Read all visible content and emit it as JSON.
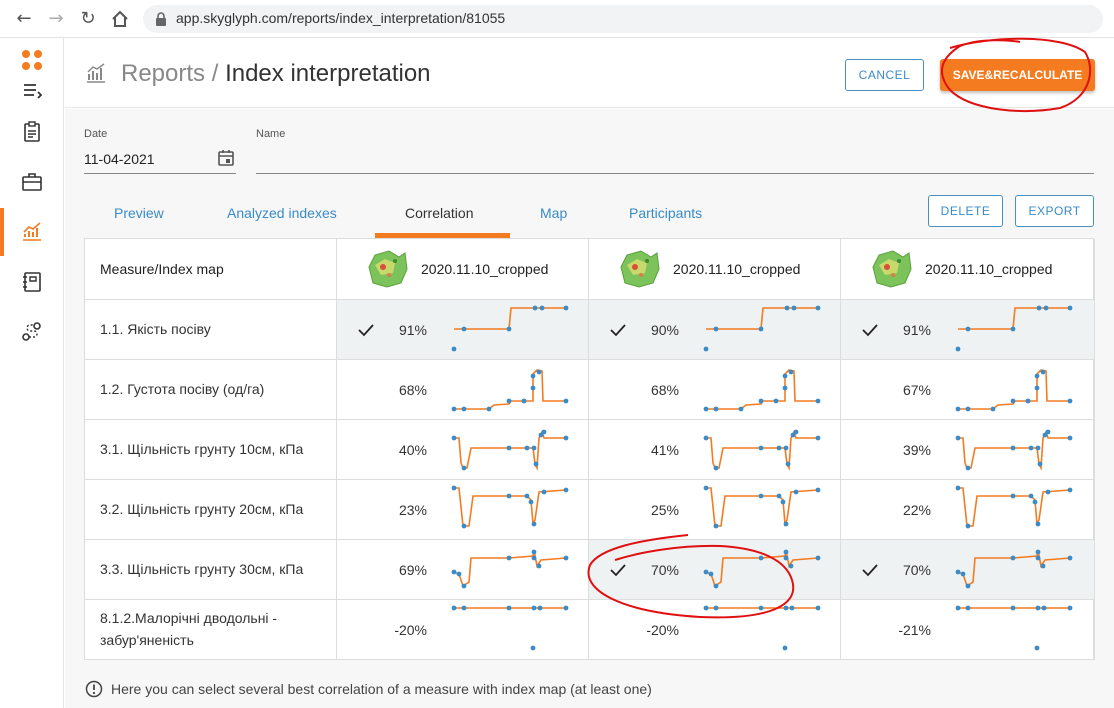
{
  "browser": {
    "url": "app.skyglyph.com/reports/index_interpretation/81055"
  },
  "sidebar": {
    "items": [
      {
        "icon": "apps-dots-icon"
      },
      {
        "icon": "menu-collapse-icon"
      },
      {
        "icon": "clipboard-icon"
      },
      {
        "icon": "briefcase-icon"
      },
      {
        "icon": "chart-growth-icon",
        "active": true
      },
      {
        "icon": "notebook-icon"
      },
      {
        "icon": "route-icon"
      }
    ]
  },
  "header": {
    "crumb": "Reports",
    "separator": " / ",
    "title": "Index interpretation",
    "cancel_label": "CANCEL",
    "save_label": "SAVE&RECALCULATE"
  },
  "form": {
    "date_label": "Date",
    "date_value": "11-04-2021",
    "name_label": "Name",
    "name_value": ""
  },
  "tabs": [
    {
      "label": "Preview"
    },
    {
      "label": "Analyzed indexes"
    },
    {
      "label": "Correlation",
      "active": true
    },
    {
      "label": "Map"
    },
    {
      "label": "Participants"
    }
  ],
  "actions": {
    "delete_label": "DELETE",
    "export_label": "EXPORT"
  },
  "table": {
    "corner_label": "Measure/Index map",
    "columns": [
      {
        "name": "2020.11.10_cropped"
      },
      {
        "name": "2020.11.10_cropped"
      },
      {
        "name": "2020.11.10_cropped"
      }
    ],
    "rows": [
      {
        "label": "1.1. Якість посіву",
        "cells": [
          {
            "value": "91%",
            "selected": true
          },
          {
            "value": "90%",
            "selected": true
          },
          {
            "value": "91%",
            "selected": true
          }
        ]
      },
      {
        "label": "1.2. Густота посіву (од/га)",
        "cells": [
          {
            "value": "68%",
            "selected": false
          },
          {
            "value": "68%",
            "selected": false
          },
          {
            "value": "67%",
            "selected": false
          }
        ]
      },
      {
        "label": "3.1. Щільність грунту 10см, кПа",
        "cells": [
          {
            "value": "40%",
            "selected": false
          },
          {
            "value": "41%",
            "selected": false
          },
          {
            "value": "39%",
            "selected": false
          }
        ]
      },
      {
        "label": "3.2. Щільність грунту 20см, кПа",
        "cells": [
          {
            "value": "23%",
            "selected": false
          },
          {
            "value": "25%",
            "selected": false
          },
          {
            "value": "22%",
            "selected": false
          }
        ]
      },
      {
        "label": "3.3. Щільність грунту 30см, кПа",
        "cells": [
          {
            "value": "69%",
            "selected": false
          },
          {
            "value": "70%",
            "selected": true
          },
          {
            "value": "70%",
            "selected": true
          }
        ]
      },
      {
        "label_line1": "8.1.2.Малорічні дводольні -",
        "label_line2": "забур'яненість",
        "cells": [
          {
            "value": "-20%",
            "selected": false
          },
          {
            "value": "-20%",
            "selected": false
          },
          {
            "value": "-21%",
            "selected": false
          }
        ]
      }
    ]
  },
  "hint": {
    "text": "Here you can select several best correlation of a measure with index map (at least one)"
  },
  "colors": {
    "accent": "#f47b20",
    "link": "#3a8bc8",
    "spark_line": "#f47b20",
    "spark_point": "#3a8bc8",
    "annotation": "#e01010"
  }
}
